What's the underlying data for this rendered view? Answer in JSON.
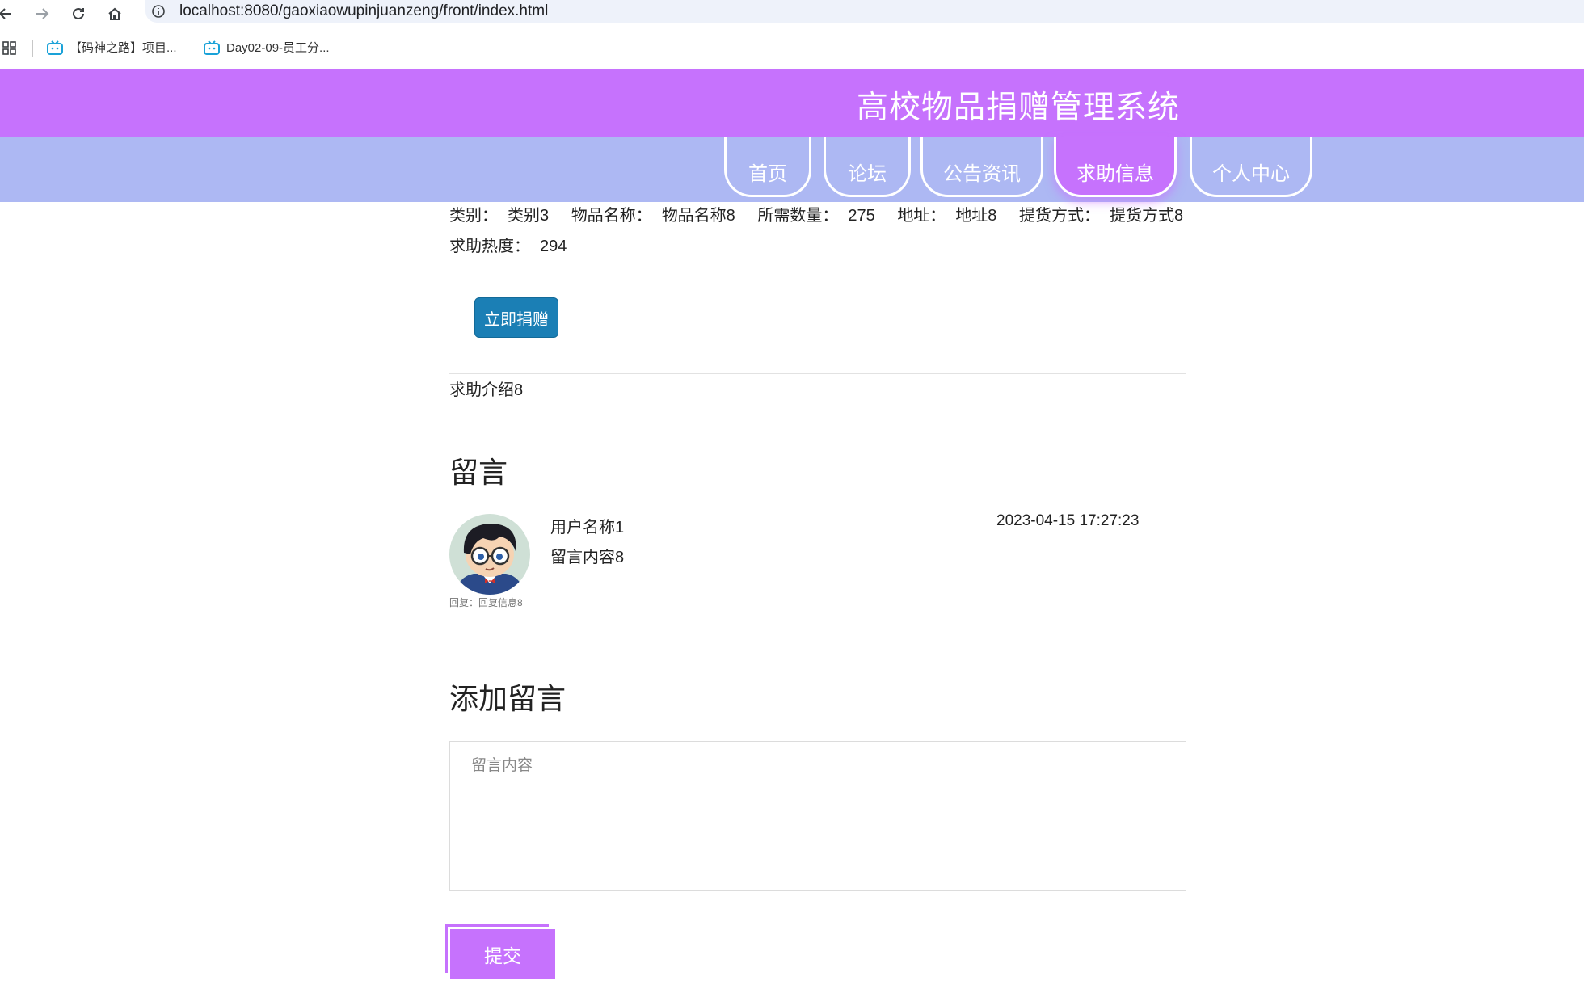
{
  "browser": {
    "url": "localhost:8080/gaoxiaowupinjuanzeng/front/index.html",
    "bookmarks": [
      {
        "label": "【码神之路】项目..."
      },
      {
        "label": "Day02-09-员工分..."
      }
    ]
  },
  "header": {
    "title": "高校物品捐赠管理系统"
  },
  "nav": {
    "items": [
      {
        "label": "首页"
      },
      {
        "label": "论坛"
      },
      {
        "label": "公告资讯"
      },
      {
        "label": "求助信息"
      },
      {
        "label": "个人中心"
      }
    ],
    "active": "求助信息"
  },
  "detail": {
    "category_label": "类别：",
    "category_value": "类别3",
    "name_label": "物品名称：",
    "name_value": "物品名称8",
    "qty_label": "所需数量：",
    "qty_value": "275",
    "addr_label": "地址：",
    "addr_value": "地址8",
    "pickup_label": "提货方式：",
    "pickup_value": "提货方式8",
    "heat_label": "求助热度：",
    "heat_value": "294",
    "donate_button": "立即捐赠",
    "intro": "求助介绍8"
  },
  "comments": {
    "title": "留言",
    "items": [
      {
        "user": "用户名称1",
        "content": "留言内容8",
        "time": "2023-04-15 17:27:23",
        "reply": "回复：回复信息8"
      }
    ]
  },
  "add_comment": {
    "title": "添加留言",
    "placeholder": "留言内容",
    "submit": "提交"
  },
  "colors": {
    "header": "#c672fd",
    "navbar": "#adb8f3",
    "donate_button": "#1b7fb5"
  }
}
